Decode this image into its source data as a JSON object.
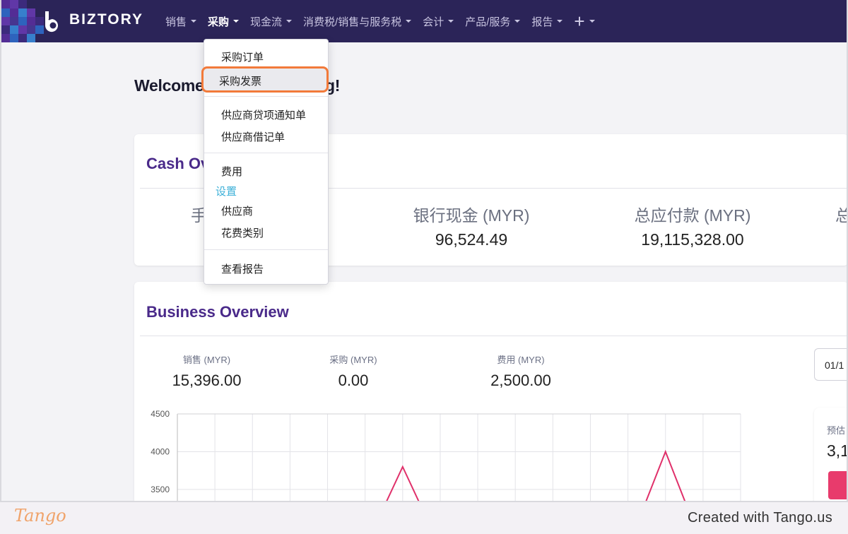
{
  "navbar": {
    "brand": "BIZTORY",
    "menu": [
      {
        "label": "销售"
      },
      {
        "label": "采购",
        "active": true
      },
      {
        "label": "现金流"
      },
      {
        "label": "消费税/销售与服务税"
      },
      {
        "label": "会计"
      },
      {
        "label": "产品/服务"
      },
      {
        "label": "报告"
      }
    ],
    "plus_symbol": "+"
  },
  "dropdown": {
    "item_purchase_order": "采购订单",
    "item_purchase_invoice": "采购发票",
    "item_supplier_credit_note": "供应商贷项通知单",
    "item_supplier_debit_note": "供应商借记单",
    "item_expenses": "费用",
    "section_settings": "设置",
    "item_suppliers": "供应商",
    "item_expense_categories": "花费类别",
    "item_view_reports": "查看报告"
  },
  "welcome": {
    "head": "Welcome",
    "tail": "g!"
  },
  "cash_overview": {
    "title": "Cash Ov",
    "col1_label_fragment": "手",
    "bank_cash_label": "银行现金 (MYR)",
    "bank_cash_value": "96,524.49",
    "total_payable_label": "总应付款 (MYR)",
    "total_payable_value": "19,115,328.00",
    "col4_label_fragment": "总"
  },
  "business_overview": {
    "title": "Business Overview",
    "sales_label": "销售 (MYR)",
    "sales_value": "15,396.00",
    "purchases_label": "采购 (MYR)",
    "purchases_value": "0.00",
    "expenses_label": "费用 (MYR)",
    "expenses_value": "2,500.00",
    "date_fragment": "01/1",
    "side_label_fragment": "预估",
    "side_value_fragment": "3,1"
  },
  "chart_data": {
    "type": "line",
    "ylim": [
      3200,
      4500
    ],
    "y_ticks": [
      "4500",
      "4000",
      "3500"
    ],
    "series": [
      {
        "color": "#e0306a",
        "values": [
          0,
          0,
          0,
          0,
          0,
          0,
          3800,
          0,
          0,
          0,
          0,
          0,
          0,
          4000,
          0,
          0
        ]
      }
    ],
    "grid": true
  },
  "footer": {
    "tango_logo": "Tango",
    "credit": "Created with Tango.us"
  },
  "colors": {
    "navbar": "#2b2458",
    "title_purple": "#4a2a8a",
    "highlight_orange": "#f27a3a",
    "settings_blue": "#3cb0d8",
    "chart_line": "#e0306a"
  }
}
